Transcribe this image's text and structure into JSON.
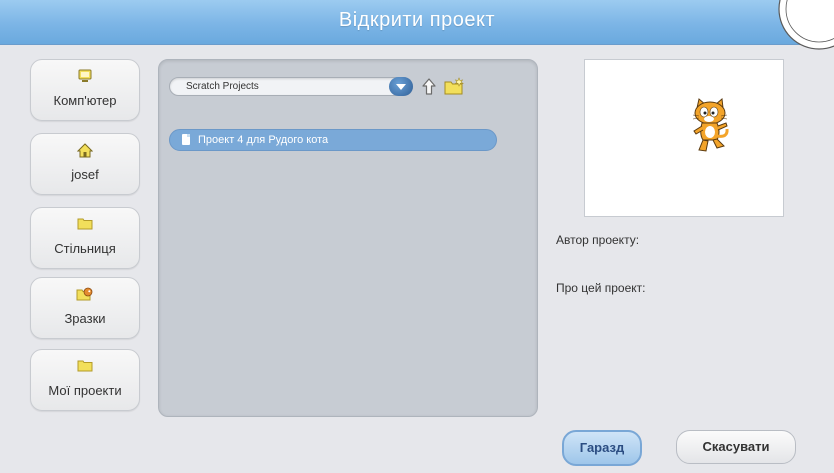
{
  "dialog": {
    "title": "Відкрити проект"
  },
  "sidebar": {
    "items": [
      {
        "label": "Комп'ютер",
        "icon": "computer-icon"
      },
      {
        "label": "josef",
        "icon": "home-icon"
      },
      {
        "label": "Стільниця",
        "icon": "folder-icon"
      },
      {
        "label": "Зразки",
        "icon": "examples-icon"
      },
      {
        "label": "Мої проекти",
        "icon": "folder-icon"
      }
    ]
  },
  "browser": {
    "path": "Scratch Projects",
    "files": [
      {
        "name": "Проект 4 для Рудого кота",
        "selected": true
      }
    ]
  },
  "details": {
    "author_label": "Автор проекту:",
    "about_label": "Про цей проект:"
  },
  "buttons": {
    "ok": "Гаразд",
    "cancel": "Скасувати"
  },
  "colors": {
    "titlebar": "#7cb5e6",
    "selection": "#7aa9d8",
    "folder": "#f2df5b"
  }
}
